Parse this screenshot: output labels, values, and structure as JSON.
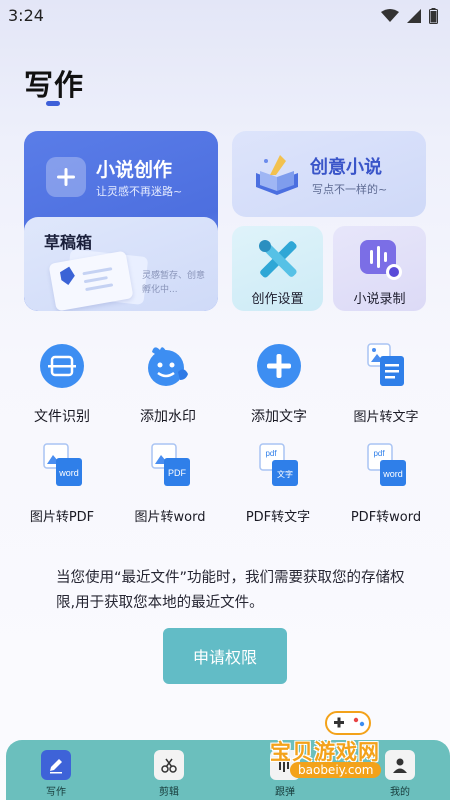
{
  "status_bar": {
    "time": "3:24"
  },
  "header": {
    "title": "写作"
  },
  "cards": {
    "novel": {
      "title": "小说创作",
      "subtitle": "让灵感不再迷路~"
    },
    "drafts": {
      "title": "草稿箱",
      "hint": "灵感暂存、创意孵化中..."
    },
    "creative": {
      "title": "创意小说",
      "subtitle": "写点不一样的~"
    },
    "settings": {
      "label": "创作设置"
    },
    "record": {
      "label": "小说录制"
    }
  },
  "tools": [
    {
      "label": "文件识别",
      "icon": "scan-icon"
    },
    {
      "label": "添加水印",
      "icon": "watermark-icon"
    },
    {
      "label": "添加文字",
      "icon": "plus-circle-icon"
    },
    {
      "label": "图片转文字",
      "icon": "image-to-text-icon"
    },
    {
      "label": "图片转PDF",
      "icon": "image-to-pdf-icon"
    },
    {
      "label": "图片转word",
      "icon": "image-to-word-icon"
    },
    {
      "label": "PDF转文字",
      "icon": "pdf-to-text-icon"
    },
    {
      "label": "PDF转word",
      "icon": "pdf-to-word-icon"
    }
  ],
  "tool_badges": {
    "word": "word",
    "pdf": "PDF",
    "pdf_lower": "pdf",
    "text": "文字"
  },
  "permission": {
    "text": "当您使用“最近文件”功能时，我们需要获取您的存储权限,用于获取您本地的最近文件。",
    "button": "申请权限"
  },
  "bottom_nav": [
    {
      "label": "写作",
      "icon": "pen-icon",
      "active": true
    },
    {
      "label": "剪辑",
      "icon": "scissors-icon",
      "active": false
    },
    {
      "label": "跟弹",
      "icon": "music-icon",
      "active": false
    },
    {
      "label": "我的",
      "icon": "user-icon",
      "active": false
    }
  ],
  "watermark": {
    "text": "宝贝游戏网",
    "url": "baobeiy.com"
  },
  "colors": {
    "accent": "#4d6fdf",
    "button": "#62bcc6",
    "nav": "#6bbfbd",
    "watermark": "#f3a21a"
  }
}
